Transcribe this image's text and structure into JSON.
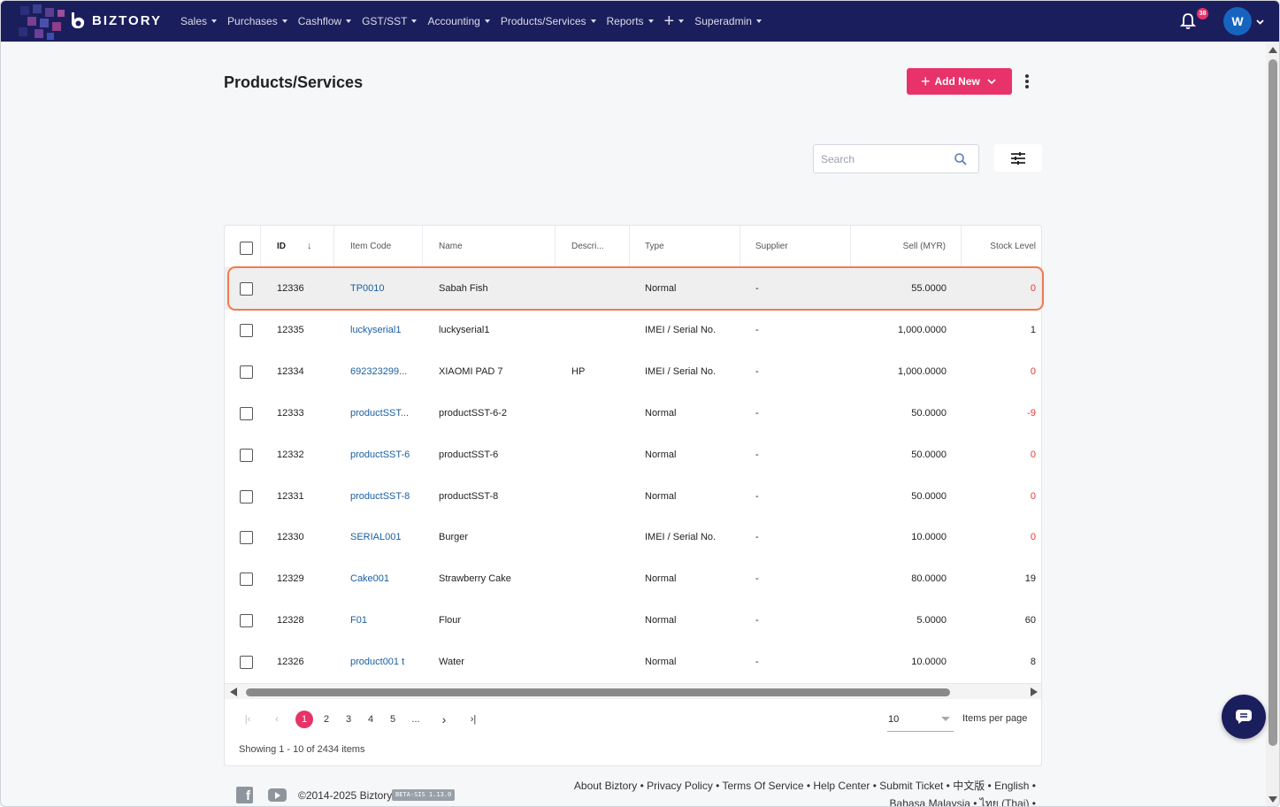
{
  "app": {
    "logo_text": "BIZTORY"
  },
  "nav": {
    "items": [
      {
        "label": "Sales"
      },
      {
        "label": "Purchases"
      },
      {
        "label": "Cashflow"
      },
      {
        "label": "GST/SST"
      },
      {
        "label": "Accounting"
      },
      {
        "label": "Products/Services"
      },
      {
        "label": "Reports"
      },
      {
        "label": "+"
      },
      {
        "label": "Superadmin"
      }
    ],
    "notification_count": "38",
    "avatar_initial": "W"
  },
  "page": {
    "title": "Products/Services",
    "add_new_label": "Add New"
  },
  "search": {
    "placeholder": "Search",
    "value": ""
  },
  "table": {
    "columns": {
      "id": "ID",
      "item_code": "Item Code",
      "name": "Name",
      "description": "Descri...",
      "type": "Type",
      "supplier": "Supplier",
      "sell": "Sell (MYR)",
      "stock": "Stock Level"
    },
    "rows": [
      {
        "id": "12336",
        "code": "TP0010",
        "name": "Sabah Fish",
        "desc": "",
        "type": "Normal",
        "supplier": "-",
        "sell": "55.0000",
        "stock": "0",
        "stock_neg": true
      },
      {
        "id": "12335",
        "code": "luckyserial1",
        "name": "luckyserial1",
        "desc": "",
        "type": "IMEI / Serial No.",
        "supplier": "-",
        "sell": "1,000.0000",
        "stock": "1",
        "stock_neg": false
      },
      {
        "id": "12334",
        "code": "692323299...",
        "name": "XIAOMI PAD 7",
        "desc": "HP",
        "type": "IMEI / Serial No.",
        "supplier": "-",
        "sell": "1,000.0000",
        "stock": "0",
        "stock_neg": true
      },
      {
        "id": "12333",
        "code": "productSST...",
        "name": "productSST-6-2",
        "desc": "",
        "type": "Normal",
        "supplier": "-",
        "sell": "50.0000",
        "stock": "-9",
        "stock_neg": true
      },
      {
        "id": "12332",
        "code": "productSST-6",
        "name": "productSST-6",
        "desc": "",
        "type": "Normal",
        "supplier": "-",
        "sell": "50.0000",
        "stock": "0",
        "stock_neg": true
      },
      {
        "id": "12331",
        "code": "productSST-8",
        "name": "productSST-8",
        "desc": "",
        "type": "Normal",
        "supplier": "-",
        "sell": "50.0000",
        "stock": "0",
        "stock_neg": true
      },
      {
        "id": "12330",
        "code": "SERIAL001",
        "name": "Burger",
        "desc": "",
        "type": "IMEI / Serial No.",
        "supplier": "-",
        "sell": "10.0000",
        "stock": "0",
        "stock_neg": true
      },
      {
        "id": "12329",
        "code": "Cake001",
        "name": "Strawberry Cake",
        "desc": "",
        "type": "Normal",
        "supplier": "-",
        "sell": "80.0000",
        "stock": "19",
        "stock_neg": false
      },
      {
        "id": "12328",
        "code": "F01",
        "name": "Flour",
        "desc": "",
        "type": "Normal",
        "supplier": "-",
        "sell": "5.0000",
        "stock": "60",
        "stock_neg": false
      },
      {
        "id": "12326",
        "code": "product001 t",
        "name": "Water",
        "desc": "",
        "type": "Normal",
        "supplier": "-",
        "sell": "10.0000",
        "stock": "8",
        "stock_neg": false
      }
    ]
  },
  "pagination": {
    "pages": [
      "1",
      "2",
      "3",
      "4",
      "5",
      "..."
    ],
    "current": "1",
    "per_page": "10",
    "per_page_label": "Items per page",
    "showing": "Showing 1 - 10 of 2434 items"
  },
  "footer": {
    "copyright": "©2014-2025 Biztory",
    "version": "BETA-SIS 1.13.0",
    "links": [
      "About Biztory",
      "Privacy Policy",
      "Terms Of Service",
      "Help Center",
      "Submit Ticket",
      "中文版",
      "English",
      "Bahasa Malaysia",
      "ไทย (Thai)"
    ]
  },
  "colors": {
    "navbar": "#1b1e5c",
    "accent": "#e8336a",
    "link": "#1a5fa3",
    "negative": "#e53935",
    "highlight": "#f07a4f"
  }
}
